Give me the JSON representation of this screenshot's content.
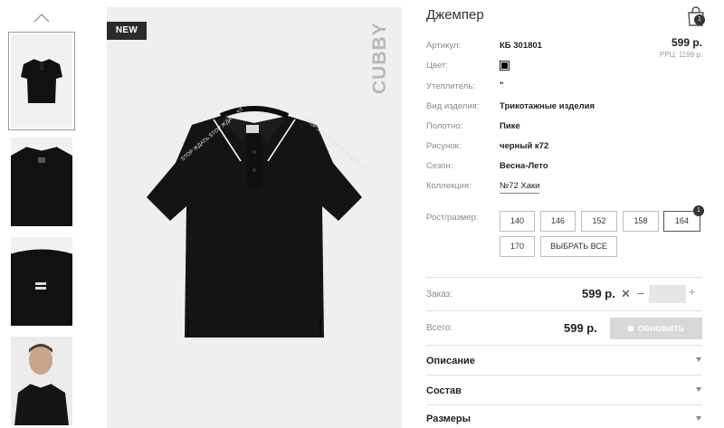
{
  "product": {
    "title": "Джемпер",
    "badge": "NEW",
    "brand": "CUBBY",
    "print_text": "STOP ЖДАТЬ STOP ЖДАТЬ ST",
    "price": "599 р.",
    "rrc": "РРЦ: 1199 р."
  },
  "cart": {
    "count": "1",
    "icon": "shopping-bag-icon"
  },
  "attributes": {
    "article": {
      "label": "Артикул:",
      "value": "КБ 301801"
    },
    "color": {
      "label": "Цвет:",
      "swatch": "#000000"
    },
    "insulation": {
      "label": "Утеплитель:",
      "value": "\""
    },
    "product_type": {
      "label": "Вид изделия:",
      "value": "Трикотажные изделия"
    },
    "fabric": {
      "label": "Полотно:",
      "value": "Пике"
    },
    "pattern": {
      "label": "Рисунок:",
      "value": "черный к72"
    },
    "season": {
      "label": "Сезон:",
      "value": "Весна-Лето"
    },
    "collection": {
      "label": "Коллекция:",
      "value": "№72 Хаки"
    }
  },
  "sizes": {
    "label": "Рост/размер:",
    "options": [
      "140",
      "146",
      "152",
      "158",
      "164",
      "170"
    ],
    "selected": "164",
    "selected_count": "1",
    "select_all": "ВЫБРАТЬ ВСЕ"
  },
  "order": {
    "label": "Заказ:",
    "price": "599 р.",
    "times": "✕",
    "minus": "–",
    "plus": "+",
    "quantity": ""
  },
  "total": {
    "label": "Всего:",
    "price": "599 р.",
    "update_label": "ОБНОВИТЬ"
  },
  "accordion": [
    "Описание",
    "Состав",
    "Размеры"
  ],
  "colors": {
    "accent_dark": "#2b2b2b",
    "button_disabled": "#d8d8d8",
    "image_bg": "#efefef"
  }
}
